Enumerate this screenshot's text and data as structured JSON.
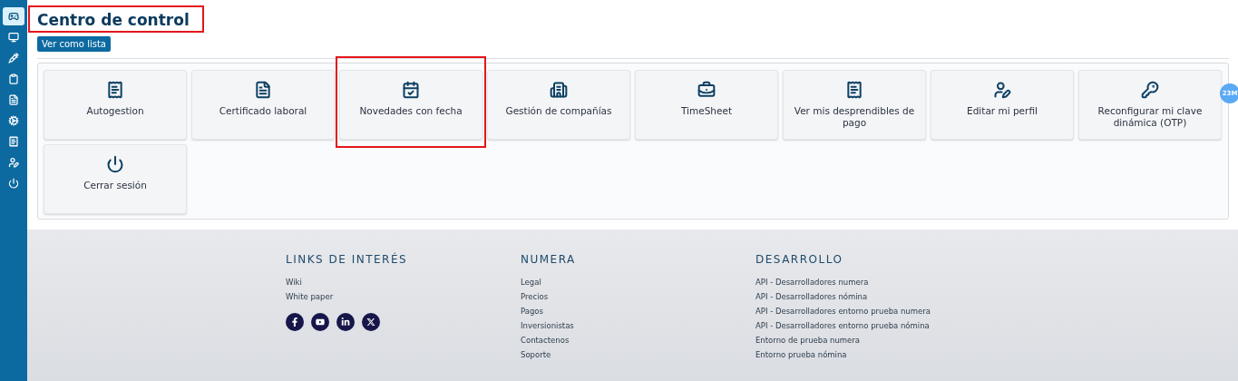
{
  "sidebar": {
    "items": [
      {
        "selected": true
      },
      {
        "selected": false
      },
      {
        "selected": false
      },
      {
        "selected": false
      },
      {
        "selected": false
      },
      {
        "selected": false
      },
      {
        "selected": false
      },
      {
        "selected": false
      },
      {
        "selected": false
      }
    ]
  },
  "header": {
    "title": "Centro de control",
    "highlighted": true,
    "view_button": "Ver como lista"
  },
  "tiles": [
    {
      "label": "Autogestion",
      "highlighted": false
    },
    {
      "label": "Certificado laboral",
      "highlighted": false
    },
    {
      "label": "Novedades con fecha",
      "highlighted": true
    },
    {
      "label": "Gestión de compañías",
      "highlighted": false
    },
    {
      "label": "TimeSheet",
      "highlighted": false
    },
    {
      "label": "Ver mis desprendibles de pago",
      "highlighted": false
    },
    {
      "label": "Editar mi perfil",
      "highlighted": false
    },
    {
      "label": "Reconfigurar mi clave dinámica (OTP)",
      "highlighted": false
    },
    {
      "label": "Cerrar sesión",
      "highlighted": false
    }
  ],
  "badge": "23M",
  "footer": {
    "columns": [
      {
        "heading": "LINKS DE INTERÉS",
        "links": [
          "Wiki",
          "White paper"
        ]
      },
      {
        "heading": "NUMERA",
        "links": [
          "Legal",
          "Precios",
          "Pagos",
          "Inversionistas",
          "Contactenos",
          "Soporte"
        ]
      },
      {
        "heading": "DESARROLLO",
        "links": [
          "API - Desarrolladores numera",
          "API - Desarrolladores nómina",
          "API - Desarrolladores entorno prueba numera",
          "API - Desarrolladores entorno prueba nómina",
          "Entorno de prueba numera",
          "Entorno prueba nómina"
        ]
      }
    ]
  }
}
